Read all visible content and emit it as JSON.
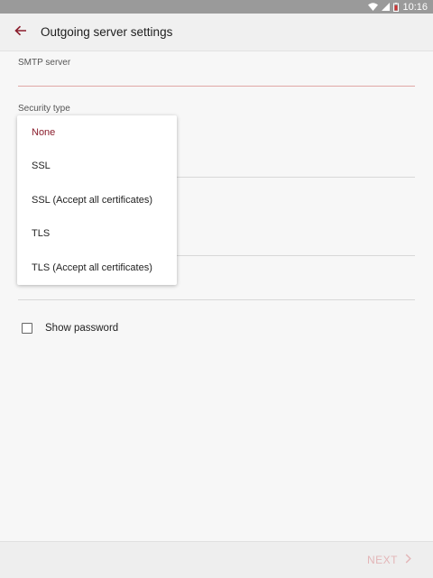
{
  "status_bar": {
    "time": "10:16",
    "icons": [
      "wifi-icon",
      "signal-icon",
      "battery-icon"
    ]
  },
  "app_bar": {
    "title": "Outgoing server settings",
    "back_icon": "arrow-left-icon"
  },
  "form": {
    "smtp_server": {
      "label": "SMTP server",
      "value": ""
    },
    "security_type": {
      "label": "Security type"
    },
    "show_password": {
      "label": "Show password",
      "checked": false
    }
  },
  "dropdown": {
    "options": [
      {
        "label": "None",
        "selected": true
      },
      {
        "label": "SSL",
        "selected": false
      },
      {
        "label": "SSL (Accept all certificates)",
        "selected": false
      },
      {
        "label": "TLS",
        "selected": false
      },
      {
        "label": "TLS (Accept all certificates)",
        "selected": false
      }
    ]
  },
  "bottom_bar": {
    "next_label": "NEXT",
    "next_icon": "chevron-right-icon"
  },
  "colors": {
    "accent": "#8a1d2c",
    "accent_light": "#e3b6b8",
    "status_bar": "#9a9a9a"
  }
}
